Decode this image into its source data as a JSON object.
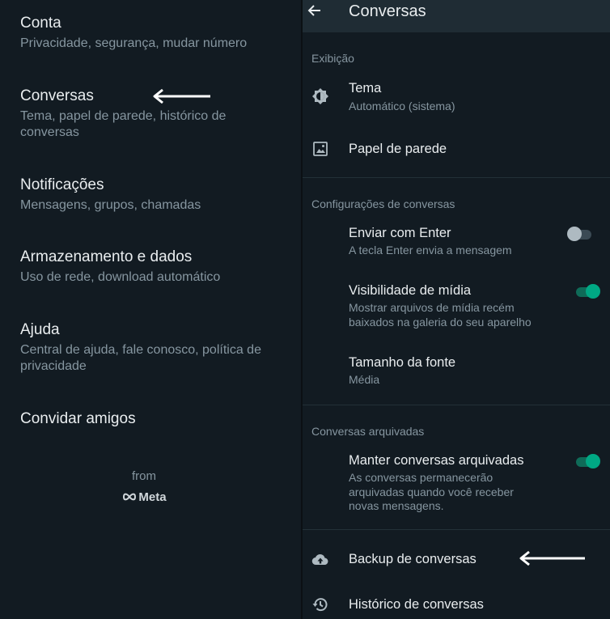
{
  "left_menu": {
    "items": [
      {
        "title": "Conta",
        "subtitle": "Privacidade, segurança, mudar número"
      },
      {
        "title": "Conversas",
        "subtitle": "Tema, papel de parede, histórico de conversas"
      },
      {
        "title": "Notificações",
        "subtitle": "Mensagens, grupos, chamadas"
      },
      {
        "title": "Armazenamento e dados",
        "subtitle": "Uso de rede, download automático"
      },
      {
        "title": "Ajuda",
        "subtitle": "Central de ajuda, fale conosco, política de privacidade"
      },
      {
        "title": "Convidar amigos"
      }
    ],
    "footer": {
      "from": "from",
      "meta": "Meta"
    }
  },
  "conversas_screen": {
    "title": "Conversas",
    "sections": {
      "display": "Exibição",
      "chat_settings": "Configurações de conversas",
      "archived": "Conversas arquivadas"
    },
    "theme": {
      "title": "Tema",
      "value": "Automático (sistema)"
    },
    "wallpaper": {
      "title": "Papel de parede"
    },
    "enter_send": {
      "title": "Enviar com Enter",
      "subtitle": "A tecla Enter envia a mensagem",
      "enabled": false
    },
    "media_visibility": {
      "title": "Visibilidade de mídia",
      "subtitle": "Mostrar arquivos de mídia recém baixados na galeria do seu aparelho",
      "enabled": true
    },
    "font_size": {
      "title": "Tamanho da fonte",
      "value": "Média"
    },
    "keep_archived": {
      "title": "Manter conversas arquivadas",
      "subtitle": "As conversas permanecerão arquivadas quando você receber novas mensagens.",
      "enabled": true
    },
    "backup": {
      "title": "Backup de conversas"
    },
    "history": {
      "title": "Histórico de conversas"
    }
  },
  "colors": {
    "accent": "#00a884",
    "background": "#121b22",
    "text": "#e9edef",
    "muted": "#8696a0"
  }
}
